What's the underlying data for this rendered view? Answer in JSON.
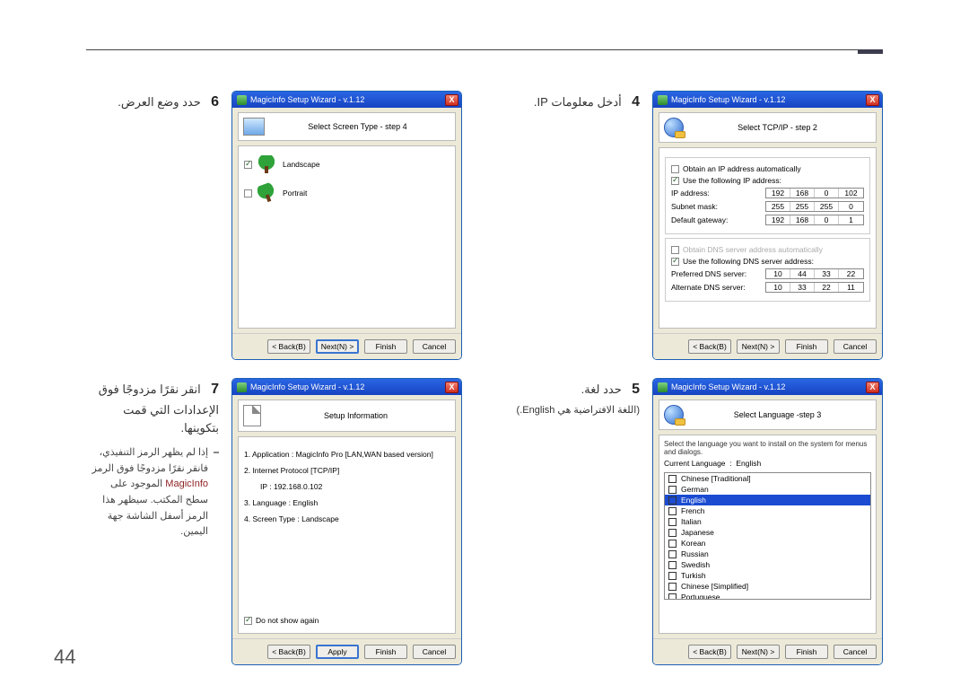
{
  "page_number": "44",
  "wizard_title": "MagicInfo Setup Wizard - v.1.12",
  "close_x": "X",
  "buttons": {
    "back": "< Back(B)",
    "next": "Next(N) >",
    "finish": "Finish",
    "cancel": "Cancel",
    "apply": "Apply"
  },
  "step4": {
    "num": "4",
    "title": "أدخل معلومات IP.",
    "panel_title": "Select TCP/IP - step 2",
    "auto_ip": "Obtain an IP address automatically",
    "use_ip": "Use the following IP address:",
    "ip_lbl": "IP address:",
    "ip": [
      "192",
      "168",
      "0",
      "102"
    ],
    "sm_lbl": "Subnet mask:",
    "sm": [
      "255",
      "255",
      "255",
      "0"
    ],
    "gw_lbl": "Default gateway:",
    "gw": [
      "192",
      "168",
      "0",
      "1"
    ],
    "auto_dns": "Obtain DNS server address automatically",
    "use_dns": "Use the following DNS server address:",
    "pdns_lbl": "Preferred DNS server:",
    "pdns": [
      "10",
      "44",
      "33",
      "22"
    ],
    "adns_lbl": "Alternate DNS server:",
    "adns": [
      "10",
      "33",
      "22",
      "11"
    ]
  },
  "step5": {
    "num": "5",
    "title": "حدد لغة.",
    "subtitle": "(اللغة الافتراضية هي English.)",
    "panel_title": "Select Language -step 3",
    "instr": "Select the language you want to install on the system for menus and dialogs.",
    "cur_lbl": "Current Language",
    "cur_val": "English",
    "langs": [
      "Chinese [Traditional]",
      "German",
      "English",
      "French",
      "Italian",
      "Japanese",
      "Korean",
      "Russian",
      "Swedish",
      "Turkish",
      "Chinese [Simplified]",
      "Portuguese"
    ],
    "selected": "English"
  },
  "step6": {
    "num": "6",
    "title": "حدد وضع العرض.",
    "panel_title": "Select Screen Type - step 4",
    "landscape": "Landscape",
    "portrait": "Portrait"
  },
  "step7": {
    "num": "7",
    "title": "انقر نقرًا مزدوجًا فوق الإعدادات التي قمت بتكوينها.",
    "tip_a": "إذا لم يظهر الرمز التنفيذي، فانقر نقرًا مزدوجًا فوق الرمز ",
    "tip_accent": "MagicInfo",
    "tip_b": " الموجود على سطح المكتب. سيظهر هذا الرمز أسفل الشاشة جهة اليمين.",
    "panel_title": "Setup Information",
    "l1": "1. Application :    MagicInfo Pro [LAN,WAN based version]",
    "l2": "2. Internet Protocol [TCP/IP]",
    "l2b": "IP :    192.168.0.102",
    "l3": "3. Language :    English",
    "l4": "4. Screen Type :    Landscape",
    "dns_chk": "Do not show again"
  }
}
